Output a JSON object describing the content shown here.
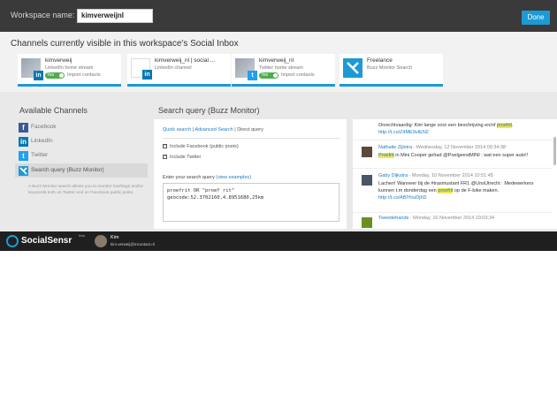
{
  "topbar": {
    "workspace_label": "Workspace name:",
    "workspace_value": "kimverweijnl",
    "done_label": "Done"
  },
  "visible": {
    "title": "Channels currently visible in this workspace's Social Inbox",
    "cards": [
      {
        "name": "kimverweij",
        "type": "LinkedIn home stream",
        "toggle": "Yes",
        "import": "Import contacts",
        "thumb_badge": "in",
        "badge_color": "#0077b5"
      },
      {
        "name": "kimverweij_nl | social ...",
        "type": "LinkedIn channel",
        "toggle": "",
        "import": "",
        "thumb_badge": "in",
        "badge_color": "#0077b5"
      },
      {
        "name": "kimverweij_nl",
        "type": "Twitter home stream",
        "toggle": "Yes",
        "import": "Import contacts",
        "thumb_badge": "t",
        "badge_color": "#1da1f2"
      },
      {
        "name": "Freelance",
        "type": "Buzz Monitor Search",
        "toggle": "",
        "import": "",
        "thumb_badge": "",
        "badge_color": "#1d9ad6"
      }
    ]
  },
  "available": {
    "title": "Available Channels",
    "items": [
      {
        "label": "Facebook",
        "icon": "f",
        "color": "#3b5998"
      },
      {
        "label": "LinkedIn",
        "icon": "in",
        "color": "#0077b5"
      },
      {
        "label": "Twitter",
        "icon": "t",
        "color": "#1da1f2"
      },
      {
        "label": "Search query (Buzz Monitor)",
        "icon": "x",
        "color": "#1d9ad6"
      }
    ],
    "buzz_desc": "A Buzz Monitor search allows you to monitor hashtags and/or keywords both on Twitter and on Facebook public posts."
  },
  "query": {
    "title": "Search query (Buzz Monitor)",
    "tab_quick": "Quick search",
    "tab_advanced": "Advanced Search",
    "tab_direct": "Direct query",
    "sep": "|",
    "chk_facebook": "Include Facebook (public posts)",
    "chk_twitter": "Include Twitter",
    "enter_label": "Enter your search query",
    "view_examples": "(view examples)",
    "query_text": "proefrit OR \"proef rit\"\ngeocode:52.3702160,4.8951680,25km"
  },
  "feed": [
    {
      "author": "",
      "meta": "",
      "text_pre": "Onrechtvaardig: Kim lange voor een beschrijving en/of ",
      "highlight": "proefrit",
      "text_post": ".",
      "link": "http://t.co/Z4ME9vtEN2"
    },
    {
      "author": "Nathalie Zijlstra",
      "meta": " - Wednesday, 12 November 2014 09:34:38",
      "text_pre": "",
      "highlight": "Proefrit",
      "text_post": " in Mini Cooper gehad @PoelgeestMINI : wat een super auto!!",
      "link": ""
    },
    {
      "author": "Gaby Dijkstra",
      "meta": " - Monday, 10 November 2014 10:51:45",
      "text_pre": "Lachen! Wanneer bij de #trasmustant FR1 @UnsUtrecht : Medewerkers kunnen t.m donderdag een ",
      "highlight": "proefrit",
      "text_post": " op de F-bike maken.",
      "link": "http://t.co/ABIYouDjhD"
    },
    {
      "author": "Tweedehands",
      "meta": " - Monday, 10 November 2014 10:03:34",
      "text_pre": "",
      "highlight": "",
      "text_post": "",
      "link": ""
    }
  ],
  "footer": {
    "brand": "SocialSensr",
    "beta": "beta",
    "user_name": "Kim",
    "user_email": "kim.verweij@mcontact.nl"
  }
}
